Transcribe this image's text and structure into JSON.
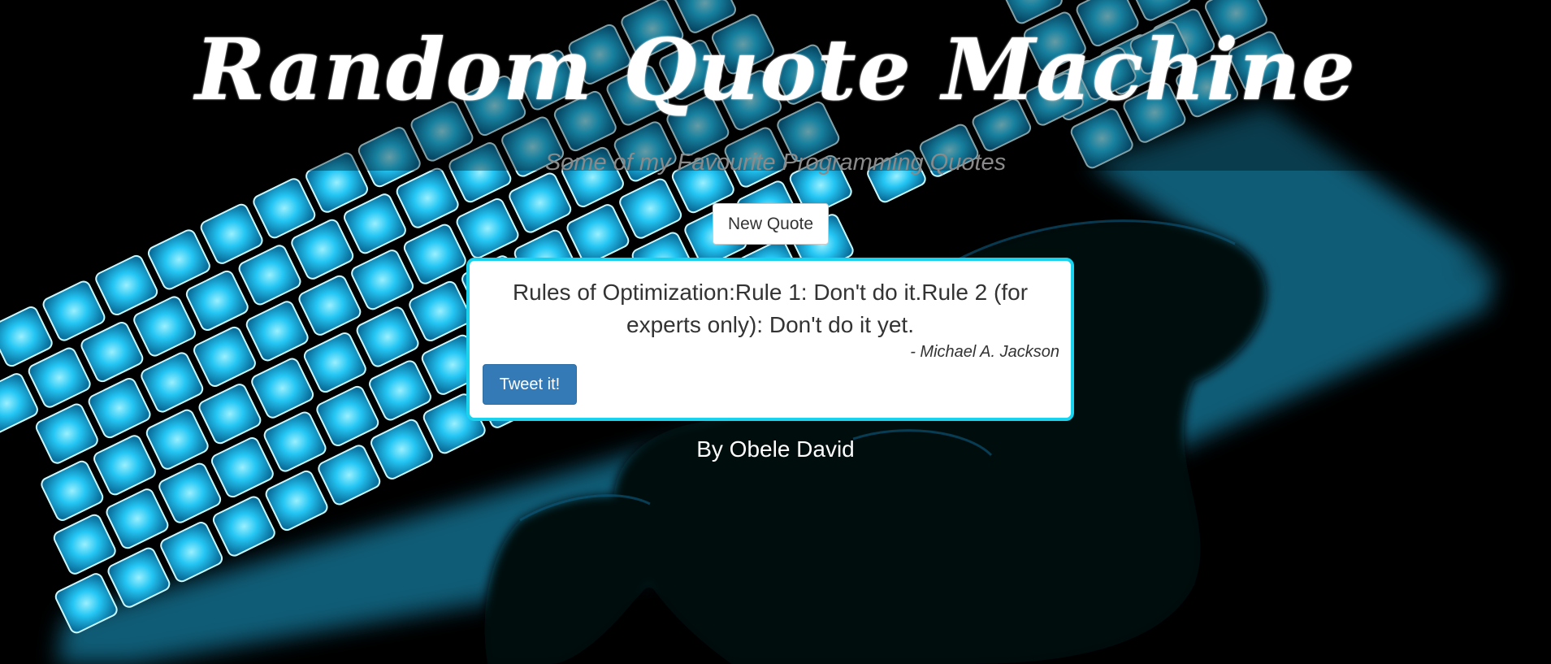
{
  "header": {
    "title": "Random Quote Machine",
    "subtitle": "Some of my Favourite Programming Quotes"
  },
  "controls": {
    "new_quote_label": "New Quote",
    "tweet_label": "Tweet it!"
  },
  "quote": {
    "text": "Rules of Optimization:Rule 1: Don't do it.Rule 2 (for experts only): Don't do it yet.",
    "author": "- Michael A. Jackson"
  },
  "footer": {
    "credit": "By Obele David"
  },
  "theme": {
    "page_background": "#000000",
    "quote_border": "#19d3ee",
    "tweet_button": "#337ab7",
    "keyboard_glow": "#27c8ff"
  },
  "background_image": "keyboard-with-glowing-blue-keys-and-hands"
}
